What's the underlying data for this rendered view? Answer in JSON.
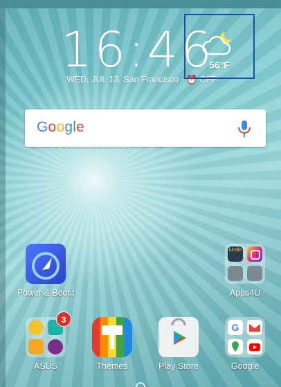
{
  "clock": {
    "time": "16:46"
  },
  "date_line": "WED, JUL 13, San Francisco · ⏰ OFF",
  "weather": {
    "temp": "56°F",
    "icon": "partly-cloudy-night-icon"
  },
  "search": {
    "logo": "Google"
  },
  "apps": {
    "power_boost": "Power & Boost",
    "apps4u": "Apps4U",
    "asus": "ASUS",
    "asus_badge": "3",
    "themes": "Themes",
    "play_store": "Play Store",
    "google": "Google"
  },
  "colors": {
    "accent_red": "#d93025",
    "highlight_border": "#1f4fa3"
  }
}
